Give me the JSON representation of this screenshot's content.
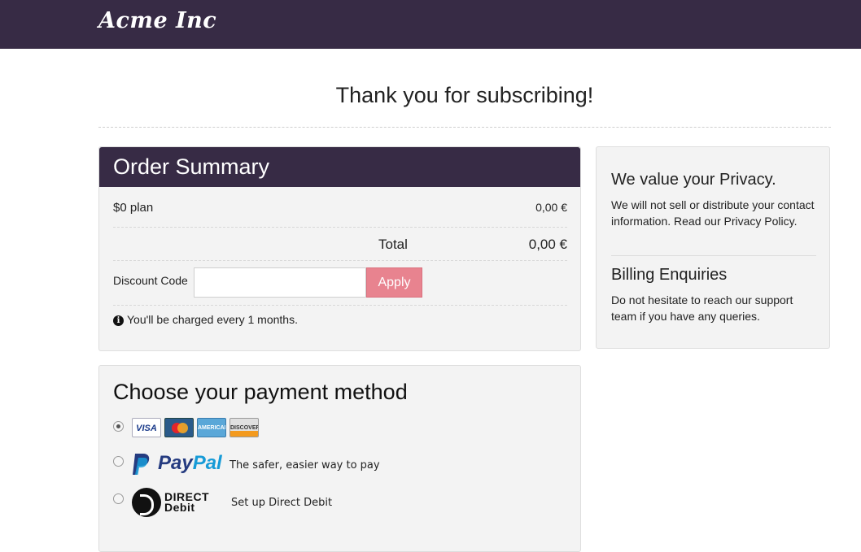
{
  "header": {
    "brand": "Acme Inc",
    "bar_color": "#372b45"
  },
  "page": {
    "title": "Thank you for subscribing!"
  },
  "order_summary": {
    "title": "Order Summary",
    "plan_label": "$0 plan",
    "plan_price": "0,00 €",
    "total_label": "Total",
    "total_value": "0,00 €",
    "discount_label": "Discount Code",
    "discount_value": "",
    "apply_label": "Apply",
    "apply_color": "#e8838f",
    "charge_note": "You'll be charged every 1 months."
  },
  "privacy": {
    "title": "We value your Privacy.",
    "text": "We will not sell or distribute your contact information. Read our Privacy Policy.",
    "billing_title": "Billing Enquiries",
    "billing_text": "Do not hesitate to reach our support team if you have any queries."
  },
  "payment": {
    "title": "Choose your payment method",
    "methods": [
      {
        "id": "card",
        "selected": true,
        "icons": [
          "visa-icon",
          "mastercard-icon",
          "american-express-icon",
          "discover-icon"
        ]
      },
      {
        "id": "paypal",
        "selected": false,
        "logo_pay": "Pay",
        "logo_pal": "Pal",
        "tagline": "The safer, easier way to pay"
      },
      {
        "id": "direct-debit",
        "selected": false,
        "logo_line1": "DIRECT",
        "logo_line2": "Debit",
        "tagline": "Set up Direct Debit"
      }
    ],
    "card_labels": {
      "visa": "VISA",
      "amex": "AMERICAN EXPRESS",
      "discover": "DISCOVER"
    }
  }
}
